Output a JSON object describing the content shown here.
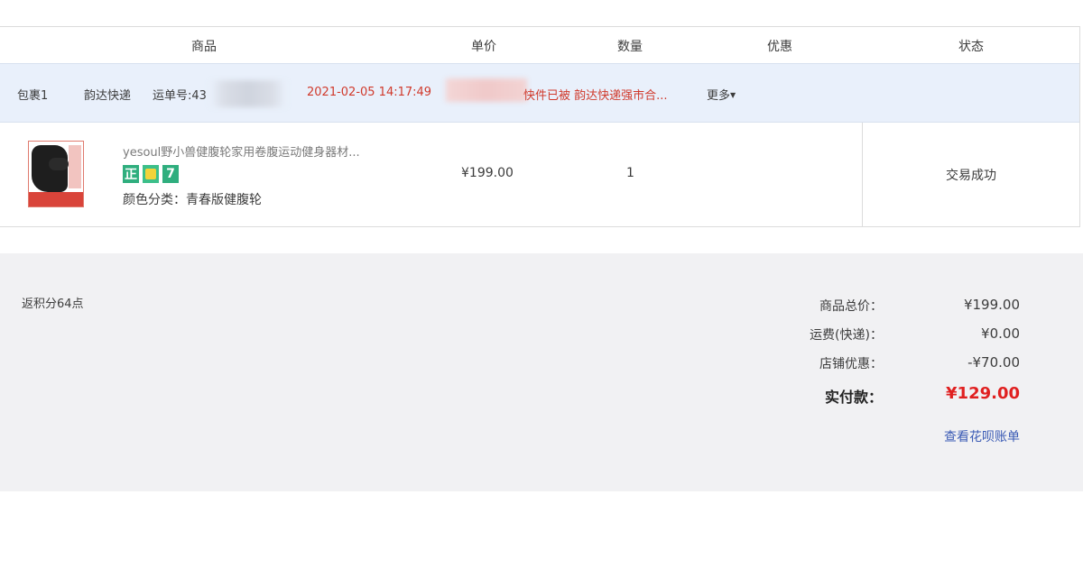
{
  "table_header": {
    "product": "商品",
    "unit_price": "单价",
    "quantity": "数量",
    "discount": "优惠",
    "status": "状态"
  },
  "package": {
    "label": "包裹1",
    "courier": "韵达快递",
    "waybill": "运单号:43",
    "time": "2021-02-05 14:17:49",
    "tracking_status": "快件已被 韵达快递强市合...",
    "more": "更多"
  },
  "item": {
    "title": "yesoul野小兽健腹轮家用卷腹运动健身器材...",
    "badges": [
      "正",
      "thumb-up-icon",
      "7"
    ],
    "variant": "颜色分类：青春版健腹轮",
    "price": "¥199.00",
    "quantity": "1",
    "status": "交易成功"
  },
  "summary": {
    "points": "返积分64点",
    "rows": [
      {
        "label": "商品总价：",
        "value": "¥199.00"
      },
      {
        "label": "运费(快递)：",
        "value": "¥0.00"
      },
      {
        "label": "店铺优惠：",
        "value": "-¥70.00"
      }
    ],
    "paid_label": "实付款：",
    "paid_value": "¥129.00",
    "bill_link": "查看花呗账单"
  },
  "colors": {
    "accent_red": "#e02020",
    "link_blue": "#3b5bb5",
    "package_bg": "#e9f0fb",
    "summary_bg": "#f1f1f3"
  }
}
